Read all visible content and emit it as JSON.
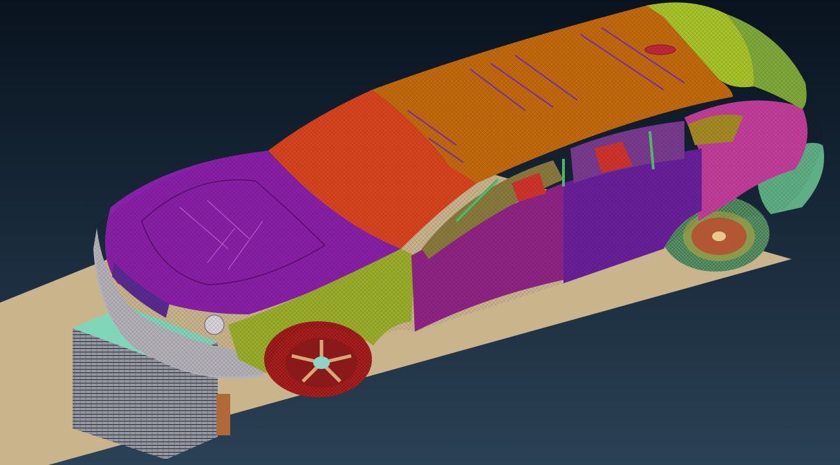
{
  "viewport": {
    "corner_label": "",
    "background_top": "#09131f",
    "background_bottom": "#2b4155"
  },
  "colors": {
    "ground_plate": "#c9b48c",
    "barrier_top": "#7fd6b9",
    "barrier_side": "#8a8c96",
    "hood": "#8a1fa8",
    "windshield": "#d8441e",
    "roof": "#c46a0e",
    "fender": "#9aae2a",
    "door_front": "#8f2486",
    "door_rear": "#6a1f9b",
    "quarter_panel": "#c23e9a",
    "rear_hatch": "#a8c42a",
    "rear_bumper": "#5fae86",
    "wheel_front": "#b31f1f",
    "wheel_rear": "#5a9a6a",
    "bumper_front": "#b4b0b8",
    "interior_frame": "#4fbf6e"
  },
  "model": {
    "name": "vehicle-fe-mesh",
    "parts": [
      "hood",
      "windshield",
      "roof",
      "front-fender",
      "front-door",
      "rear-door",
      "quarter-panel",
      "rear-hatch",
      "rear-bumper",
      "front-bumper",
      "front-wheel",
      "rear-wheel",
      "impact-barrier",
      "ground-plate"
    ]
  }
}
